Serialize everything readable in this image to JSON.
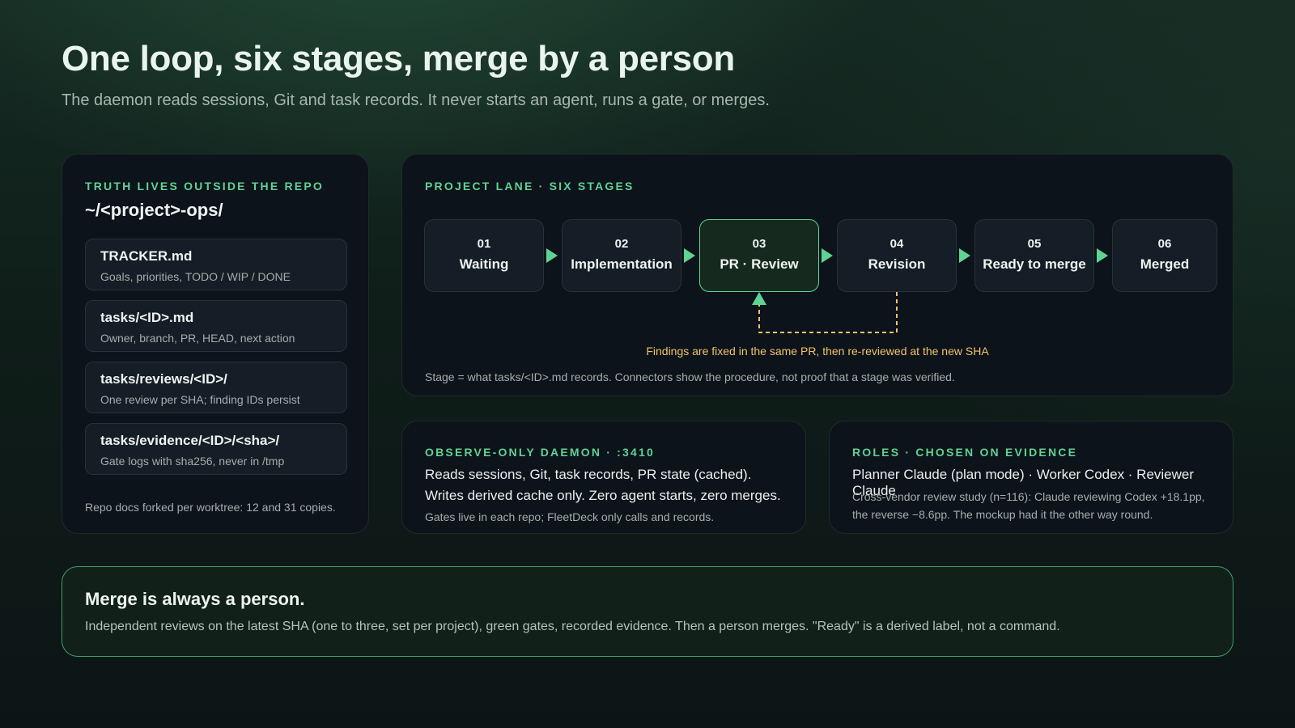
{
  "title": "One loop, six stages, merge by a person",
  "subtitle": "The daemon reads sessions, Git and task records. It never starts an agent, runs a gate, or merges.",
  "colors": {
    "accent": "#5fd394",
    "loop": "#f0c36a",
    "panel": "#0d131a"
  },
  "truth": {
    "eyebrow": "TRUTH LIVES OUTSIDE THE REPO",
    "path": "~/<project>-ops/",
    "files": [
      {
        "name": "TRACKER.md",
        "desc": "Goals, priorities, TODO / WIP / DONE"
      },
      {
        "name": "tasks/<ID>.md",
        "desc": "Owner, branch, PR, HEAD, next action"
      },
      {
        "name": "tasks/reviews/<ID>/",
        "desc": "One review per SHA; finding IDs persist"
      },
      {
        "name": "tasks/evidence/<ID>/<sha>/",
        "desc": "Gate logs with sha256, never in /tmp"
      }
    ],
    "note": "Repo docs forked per worktree: 12 and 31 copies."
  },
  "lane": {
    "eyebrow": "PROJECT LANE · SIX STAGES",
    "stages": [
      {
        "num": "01",
        "name": "Waiting"
      },
      {
        "num": "02",
        "name": "Implementation"
      },
      {
        "num": "03",
        "name": "PR · Review",
        "active": true
      },
      {
        "num": "04",
        "name": "Revision"
      },
      {
        "num": "05",
        "name": "Ready to merge"
      },
      {
        "num": "06",
        "name": "Merged"
      }
    ],
    "loop_note": "Findings are fixed in the same PR, then re-reviewed at the new SHA",
    "footnote": "Stage = what tasks/<ID>.md records. Connectors show the procedure, not proof that a stage was verified."
  },
  "daemon": {
    "eyebrow": "OBSERVE-ONLY DAEMON · :3410",
    "line1": "Reads sessions, Git, task records, PR state (cached).",
    "line2": "Writes derived cache only. Zero agent starts, zero merges.",
    "note": "Gates live in each repo; FleetDeck only calls and records."
  },
  "roles": {
    "eyebrow": "ROLES · CHOSEN ON EVIDENCE",
    "line1": "Planner Claude (plan mode) · Worker Codex · Reviewer Claude",
    "note1": "Cross-vendor review study (n=116): Claude reviewing Codex +18.1pp,",
    "note2": "the reverse −8.6pp. The mockup had it the other way round."
  },
  "merge": {
    "title": "Merge is always a person.",
    "text": "Independent reviews on the latest SHA (one to three, set per project), green gates, recorded evidence. Then a person merges. \"Ready\" is a derived label, not a command."
  }
}
